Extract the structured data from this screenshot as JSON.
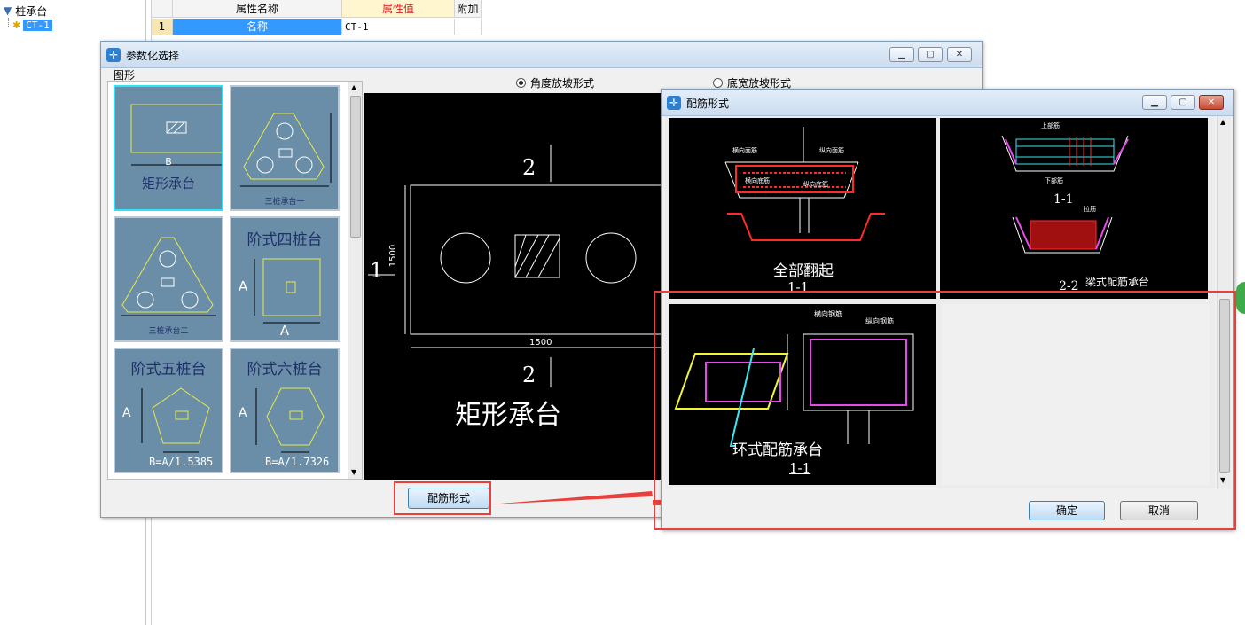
{
  "tree": {
    "root_label": "桩承台",
    "child_label": "CT-1"
  },
  "grid": {
    "headers": [
      "属性名称",
      "属性值",
      "附加"
    ],
    "rows": [
      {
        "index": "1",
        "name": "名称",
        "value": "CT-1"
      }
    ]
  },
  "param_window": {
    "title": "参数化选择",
    "group_label": "图形",
    "radio_options": [
      "角度放坡形式",
      "底宽放坡形式"
    ],
    "thumbnails": {
      "rect": {
        "caption": "矩形承台",
        "dim_b": "B"
      },
      "tri1": {
        "caption": "三桩承台一"
      },
      "tri2": {
        "caption": "三桩承台二"
      },
      "step4": {
        "caption": "阶式四桩台",
        "dim_a_side": "A",
        "dim_a_bottom": "A"
      },
      "step5": {
        "caption": "阶式五桩台",
        "dim_a": "A",
        "formula": "B=A/1.5385"
      },
      "step6": {
        "caption": "阶式六桩台",
        "dim_a": "A",
        "formula": "B=A/1.7326"
      }
    },
    "preview": {
      "section_top": "2",
      "section_bottom": "2",
      "section_left": "1",
      "dim_vertical": "1500",
      "dim_horizontal": "1500",
      "caption": "矩形承台"
    },
    "button_label": "配筋形式"
  },
  "rebar_window": {
    "title": "配筋形式",
    "panels": [
      {
        "caption": "全部翻起",
        "section": "1-1",
        "labels": [
          "横向面筋",
          "纵向面筋",
          "横向底筋",
          "纵向底筋"
        ]
      },
      {
        "caption": "梁式配筋承台",
        "sections": [
          "1-1",
          "2-2"
        ],
        "labels": [
          "上部筋",
          "下部筋",
          "拉筋"
        ]
      },
      {
        "caption": "环式配筋承台",
        "section": "1-1",
        "labels": [
          "横向钢筋",
          "纵向钢筋"
        ]
      }
    ],
    "ok_label": "确定",
    "cancel_label": "取消"
  },
  "colors": {
    "highlight": "#e8403c",
    "selected_thumb": "#2de4f3",
    "thumb_bg": "#6a8ea8",
    "cad_bg": "#000000"
  }
}
